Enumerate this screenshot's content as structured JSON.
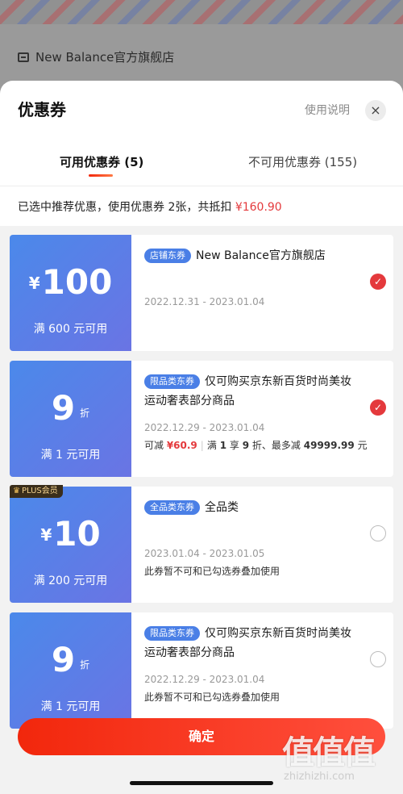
{
  "background": {
    "store_name": "New Balance官方旗舰店"
  },
  "sheet": {
    "title": "优惠券",
    "help_link": "使用说明",
    "close_icon": "×",
    "tabs": [
      {
        "label": "可用优惠券 (5)",
        "active": true
      },
      {
        "label": "不可用优惠券 (155)",
        "active": false
      }
    ],
    "summary_text": "已选中推荐优惠，使用优惠券 2张，共抵扣 ",
    "summary_amount": "¥160.90"
  },
  "coupons": [
    {
      "prefix": "¥",
      "value": "100",
      "suffix": "",
      "condition": "满 600 元可用",
      "tag": "店铺东券",
      "title": "New Balance官方旗舰店",
      "date": "2022.12.31 - 2023.01.04",
      "selected": true
    },
    {
      "prefix": "",
      "value": "9",
      "suffix": "折",
      "condition": "满 1 元可用",
      "tag": "限品类东券",
      "title": "仅可购买京东新百货时尚美妆运动奢表部分商品",
      "date": "2022.12.29 - 2023.01.04",
      "note_prefix": "可减 ",
      "note_amount": "¥60.9",
      "note_sep": "|",
      "note_a": "满",
      "note_b": "1",
      "note_c": "享",
      "note_d": "9",
      "note_e": "折、最多减",
      "note_f": "49999.99",
      "note_g": "元",
      "selected": true
    },
    {
      "badge": "PLUS会员",
      "badge_icon": "♛",
      "prefix": "¥",
      "value": "10",
      "suffix": "",
      "condition": "满 200 元可用",
      "tag": "全品类东券",
      "title": "全品类",
      "date": "2023.01.04 - 2023.01.05",
      "note": "此券暂不可和已勾选券叠加使用",
      "selected": false
    },
    {
      "prefix": "",
      "value": "9",
      "suffix": "折",
      "condition": "满 1 元可用",
      "tag": "限品类东券",
      "title": "仅可购买京东新百货时尚美妆运动奢表部分商品",
      "date": "2022.12.29 - 2023.01.04",
      "note": "此券暂不可和已勾选券叠加使用",
      "selected": false
    }
  ],
  "check_glyph": "✓",
  "confirm_label": "确定",
  "watermark": {
    "text": "值值值",
    "url": "zhizhizhi.com"
  },
  "colors": {
    "accent": "#e4393c",
    "coupon_blue": "#4b89ea",
    "button": "#f2270c"
  }
}
